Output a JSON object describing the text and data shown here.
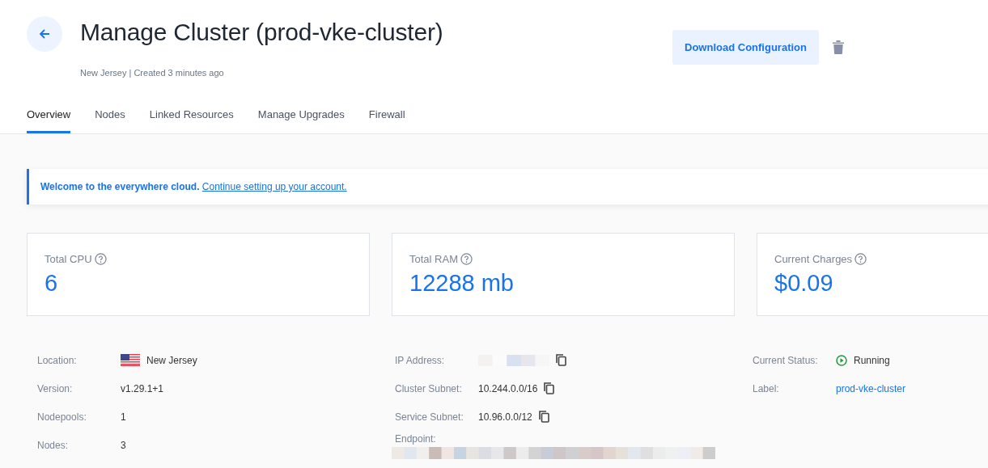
{
  "header": {
    "title": "Manage Cluster (prod-vke-cluster)",
    "subtitle": "New Jersey | Created 3 minutes ago",
    "download_button": "Download Configuration"
  },
  "tabs": [
    {
      "label": "Overview",
      "selected": true
    },
    {
      "label": "Nodes",
      "selected": false
    },
    {
      "label": "Linked Resources",
      "selected": false
    },
    {
      "label": "Manage Upgrades",
      "selected": false
    },
    {
      "label": "Firewall",
      "selected": false
    }
  ],
  "banner": {
    "message": "Welcome to the everywhere cloud.",
    "link": "Continue setting up your account."
  },
  "stats": [
    {
      "label": "Total CPU",
      "value": "6"
    },
    {
      "label": "Total RAM",
      "value": "12288 mb"
    },
    {
      "label": "Current Charges",
      "value": "$0.09"
    }
  ],
  "details": [
    [
      {
        "label": "Location:",
        "kind": "location",
        "value": "New Jersey"
      },
      {
        "label": "Version:",
        "kind": "text",
        "value": "v1.29.1+1"
      },
      {
        "label": "Nodepools:",
        "kind": "text",
        "value": "1"
      },
      {
        "label": "Nodes:",
        "kind": "text",
        "value": "3"
      }
    ],
    [
      {
        "label": "IP Address:",
        "kind": "redacted",
        "copyable": true
      },
      {
        "label": "Cluster Subnet:",
        "kind": "text",
        "value": "10.244.0.0/16",
        "copyable": true
      },
      {
        "label": "Service Subnet:",
        "kind": "text",
        "value": "10.96.0.0/12",
        "copyable": true
      },
      {
        "label": "Endpoint:",
        "kind": "redacted_block"
      }
    ],
    [
      {
        "label": "Current Status:",
        "kind": "status",
        "value": "Running"
      },
      {
        "label": "Label:",
        "kind": "link",
        "value": "prod-vke-cluster"
      }
    ]
  ]
}
